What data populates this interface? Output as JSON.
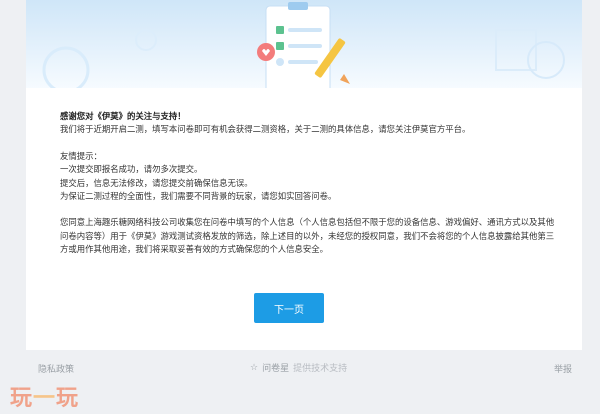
{
  "intro": {
    "title": "感谢您对《伊莫》的关注与支持！",
    "line1": "我们将于近期开启二测，填写本问卷即可有机会获得二测资格，关于二测的具体信息，请您关注伊莫官方平台。"
  },
  "tips": {
    "heading": "友情提示：",
    "items": [
      "一次提交即报名成功，请勿多次提交。",
      "提交后，信息无法修改，请您提交前确保信息无误。",
      "为保证二测过程的全面性，我们需要不同背景的玩家，请您如实回答问卷。"
    ]
  },
  "consent": {
    "text": "您同意上海趣乐糖网络科技公司收集您在问卷中填写的个人信息（个人信息包括但不限于您的设备信息、游戏偏好、通讯方式以及其他问卷内容等）用于《伊莫》游戏测试资格发放的筛选，除上述目的以外，未经您的授权同意，我们不会将您的个人信息披露给其他第三方或用作其他用途，我们将采取妥善有效的方式确保您的个人信息安全。"
  },
  "next_button": "下一页",
  "footer": {
    "privacy": "隐私政策",
    "brand": "问卷星",
    "support": "提供技术支持",
    "report": "举报"
  },
  "watermark": {
    "left": "玩",
    "mid": "一",
    "right": "玩"
  },
  "colors": {
    "accent": "#1d9ce5",
    "banner": "#d4e9f9",
    "page_bg": "#eef0f3"
  },
  "icons": [
    "checklist-illustration-icon",
    "pencil-icon",
    "star-icon"
  ]
}
